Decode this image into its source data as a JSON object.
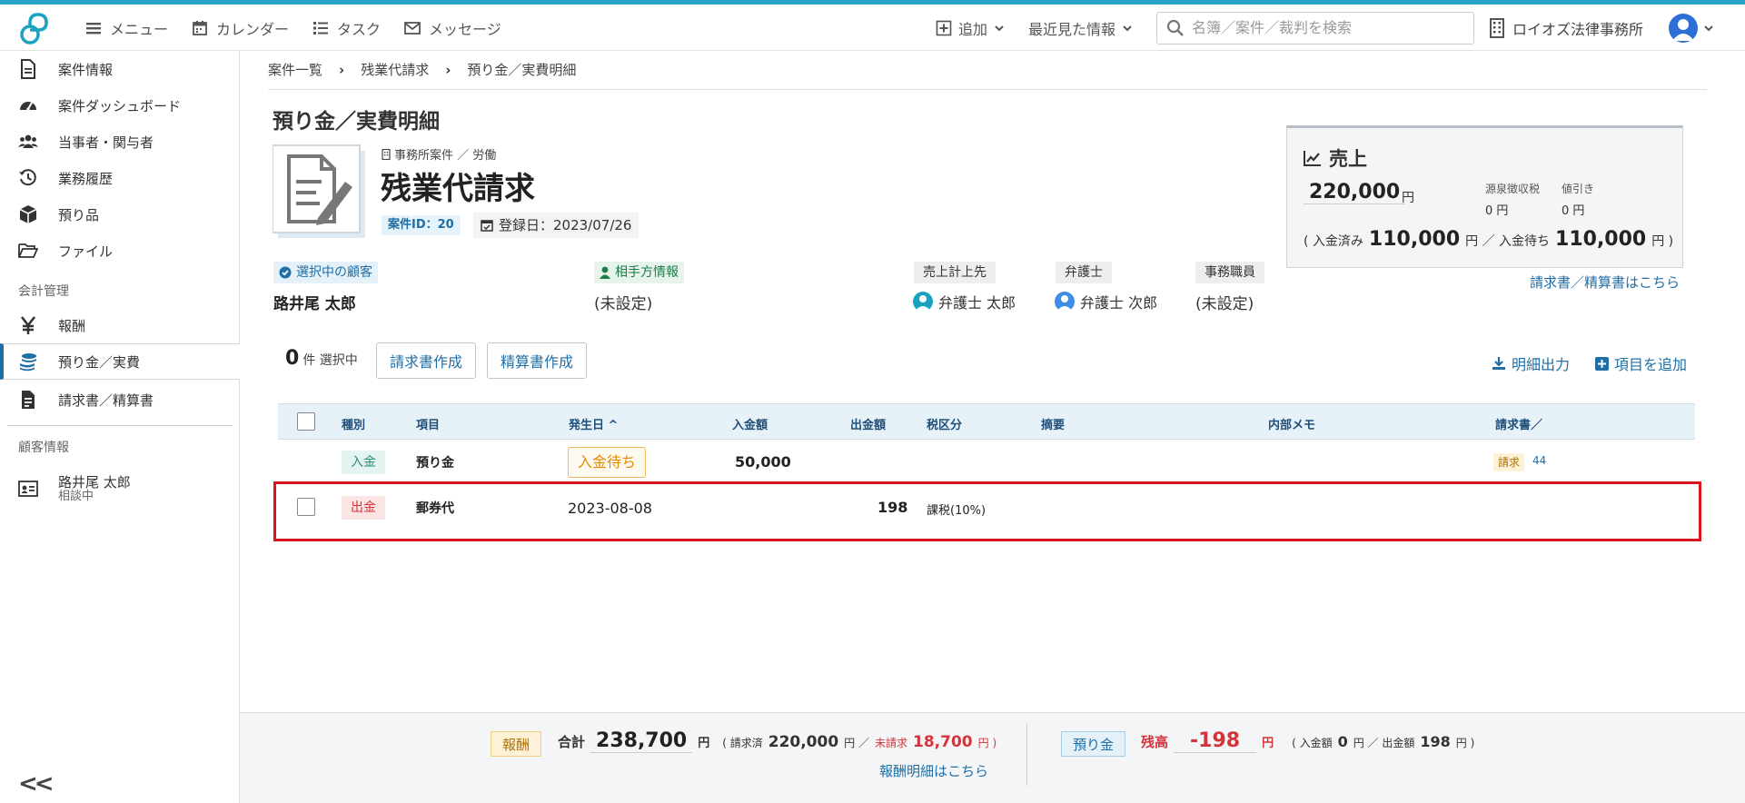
{
  "header": {
    "nav": [
      {
        "label": "メニュー"
      },
      {
        "label": "カレンダー"
      },
      {
        "label": "タスク"
      },
      {
        "label": "メッセージ"
      }
    ],
    "add_label": "追加",
    "recent_label": "最近見た情報",
    "search_placeholder": "名簿／案件／裁判を検索",
    "office_name": "ロイオズ法律事務所",
    "accent_color": "#29a3c7"
  },
  "sidebar": {
    "items": [
      {
        "label": "案件情報"
      },
      {
        "label": "案件ダッシュボード"
      },
      {
        "label": "当事者・関与者"
      },
      {
        "label": "業務履歴"
      },
      {
        "label": "預り品"
      },
      {
        "label": "ファイル"
      }
    ],
    "section_accounting": "会計管理",
    "accounting_items": [
      {
        "label": "報酬"
      },
      {
        "label": "預り金／実費"
      },
      {
        "label": "請求書／精算書"
      }
    ],
    "section_client": "顧客情報",
    "client": {
      "name": "路井尾 太郎",
      "status": "相談中"
    }
  },
  "breadcrumb": [
    "案件一覧",
    "残業代請求",
    "預り金／実費明細"
  ],
  "page_title": "預り金／実費明細",
  "case": {
    "type": "事務所案件 ／ 労働",
    "name": "残業代請求",
    "id_label": "案件ID：20",
    "registered": "登録日：2023/07/26"
  },
  "parties": {
    "client_label": "選択中の顧客",
    "client_value": "路井尾 太郎",
    "opponent_label": "相手方情報",
    "opponent_value": "(未設定)",
    "sales_to_label": "売上計上先",
    "sales_to_value": "弁護士 太郎",
    "lawyer_label": "弁護士",
    "lawyer_value": "弁護士 次郎",
    "staff_label": "事務職員",
    "staff_value": "(未設定)"
  },
  "sales": {
    "title": "売上",
    "amount": "220,000",
    "yen": "円",
    "withholding_label": "源泉徴収税",
    "withholding_value": "0 円",
    "discount_label": "値引き",
    "discount_value": "0 円",
    "paid_prefix": "( 入金済み",
    "paid_amount": "110,000",
    "pending_mid": "円 ／ 入金待ち",
    "pending_amount": "110,000",
    "suffix": "円 )",
    "invoice_link": "請求書／精算書はこちら"
  },
  "toolbar": {
    "selected_count": "0",
    "selected_suffix": "件 選択中",
    "invoice_button": "請求書作成",
    "settlement_button": "精算書作成",
    "export_label": "明細出力",
    "add_item_label": "項目を追加"
  },
  "table": {
    "columns": [
      "種別",
      "項目",
      "発生日",
      "入金額",
      "出金額",
      "税区分",
      "摘要",
      "内部メモ",
      "請求書／"
    ],
    "rows": [
      {
        "kind": "入金",
        "item": "預り金",
        "status": "入金待ち",
        "date": "",
        "deposit": "50,000",
        "withdrawal": "",
        "tax": "",
        "invoice_badge": "請求",
        "invoice_no": "44"
      },
      {
        "kind": "出金",
        "item": "郵券代",
        "status": "",
        "date": "2023-08-08",
        "deposit": "",
        "withdrawal": "198",
        "tax": "課税(10%)",
        "invoice_badge": "",
        "invoice_no": ""
      }
    ]
  },
  "footer": {
    "reward_badge": "報酬",
    "total_label": "合計",
    "total_amount": "238,700",
    "yen": "円",
    "billed_prefix": "( 請求済",
    "billed_amount": "220,000",
    "unbilled_mid": "円 ／",
    "unbilled_label": "未請求",
    "unbilled_amount": "18,700",
    "unbilled_suffix": "円 )",
    "reward_link": "報酬明細はこちら",
    "deposit_badge": "預り金",
    "balance_label": "残高",
    "balance_amount": "-198",
    "in_prefix": "( 入金額",
    "in_amount": "0",
    "out_mid": "円 ／ 出金額",
    "out_amount": "198",
    "out_suffix": "円 )"
  }
}
